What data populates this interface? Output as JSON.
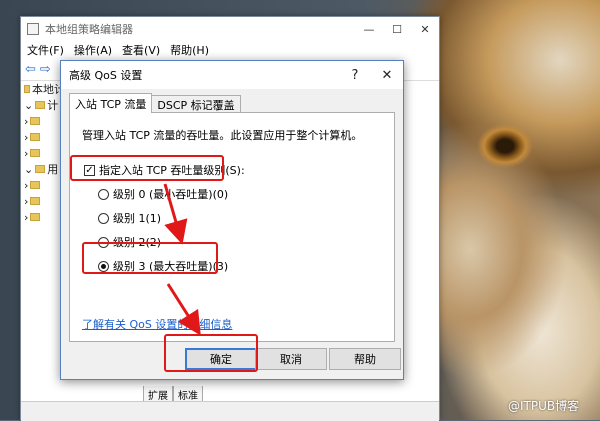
{
  "editor": {
    "title": "本地组策略编辑器",
    "menu": [
      "文件(F)",
      "操作(A)",
      "查看(V)",
      "帮助(H)"
    ],
    "tree": [
      "本地计",
      "计",
      "",
      "",
      "",
      "用",
      "",
      "",
      ""
    ],
    "bottom_tabs": [
      "扩展",
      "标准"
    ]
  },
  "dialog": {
    "title": "高级 QoS 设置",
    "help_btn": "?",
    "close_btn": "✕",
    "tabs": [
      "入站 TCP 流量",
      "DSCP 标记覆盖"
    ],
    "description": "管理入站 TCP 流量的吞吐量。此设置应用于整个计算机。",
    "checkbox_label": "指定入站 TCP 吞吐量级别(S):",
    "checkbox_checked": true,
    "levels": [
      {
        "label": "级别 0 (最小吞吐量)(0)",
        "selected": false
      },
      {
        "label": "级别 1(1)",
        "selected": false
      },
      {
        "label": "级别 2(2)",
        "selected": false
      },
      {
        "label": "级别 3 (最大吞吐量)(3)",
        "selected": true
      }
    ],
    "link_text": "了解有关 QoS 设置的详细信息",
    "ok": "确定",
    "cancel": "取消",
    "help": "帮助"
  },
  "annotation_color": "#e01818",
  "watermark": "@ITPUB博客"
}
